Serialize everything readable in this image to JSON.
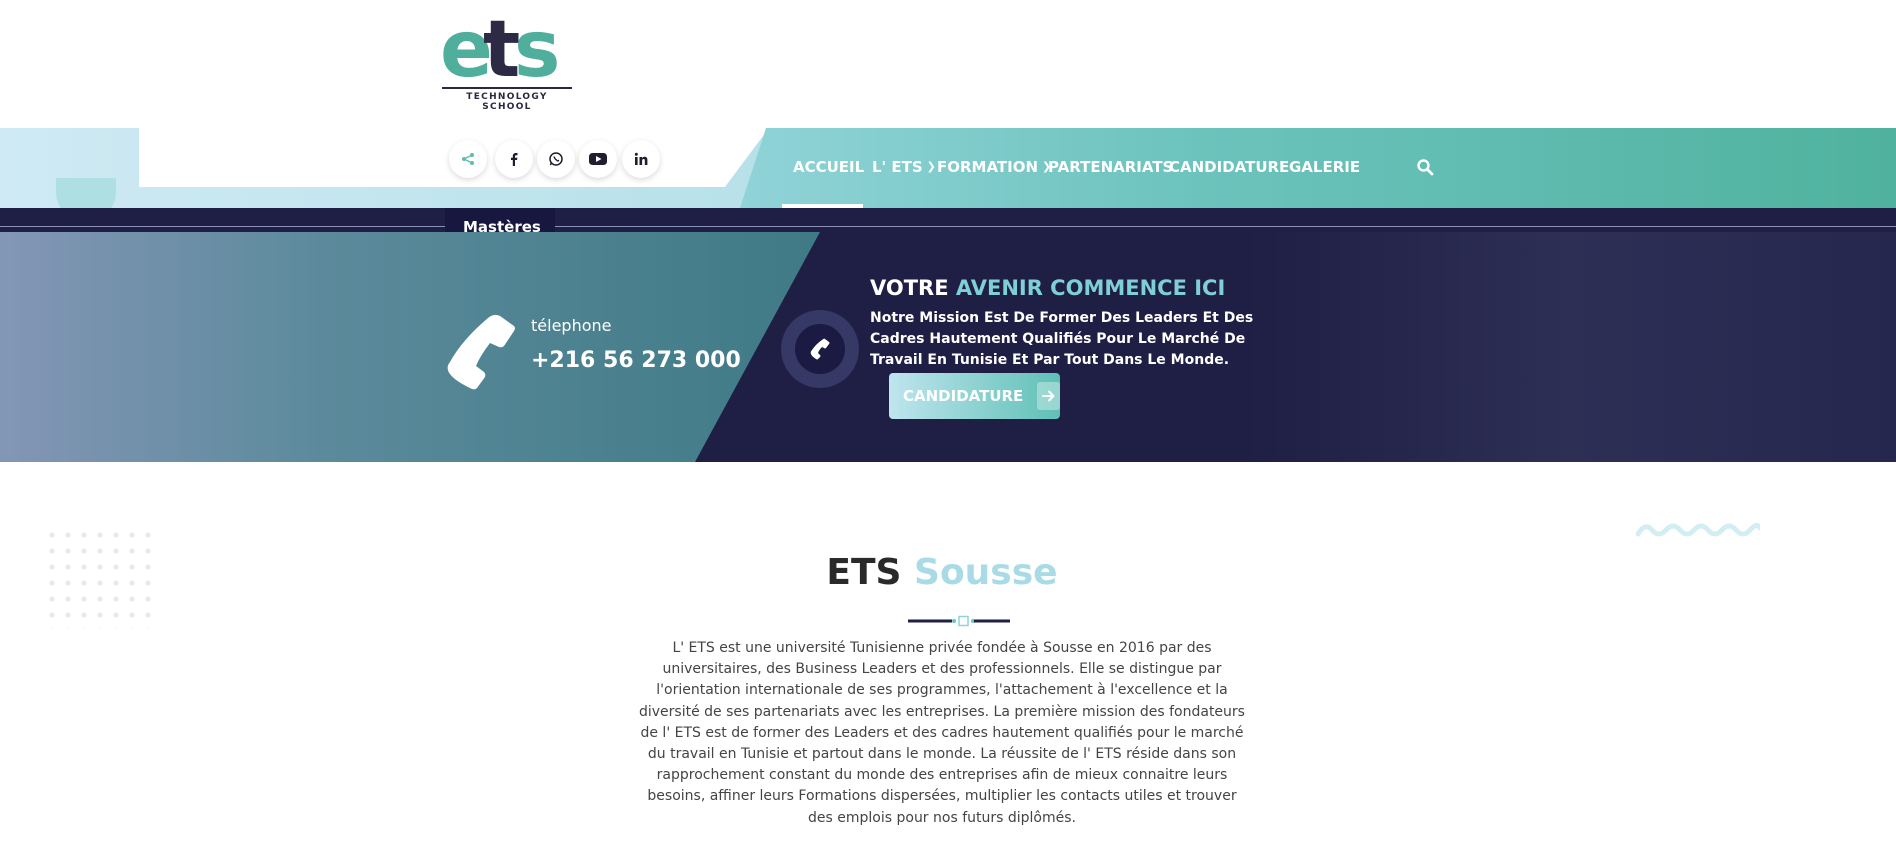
{
  "logo": {
    "wordmark": "ets",
    "tagline": "TECHNOLOGY SCHOOL"
  },
  "social": [
    {
      "icon": "share-icon",
      "name": "share"
    },
    {
      "icon": "facebook-icon",
      "name": "facebook"
    },
    {
      "icon": "whatsapp-icon",
      "name": "whatsapp"
    },
    {
      "icon": "youtube-icon",
      "name": "youtube"
    },
    {
      "icon": "linkedin-icon",
      "name": "linkedin"
    }
  ],
  "nav": {
    "items": [
      {
        "label": "ACCUEIL",
        "active": true,
        "has_dropdown": false
      },
      {
        "label": "L' ETS",
        "active": false,
        "has_dropdown": true
      },
      {
        "label": "FORMATION",
        "active": false,
        "has_dropdown": true
      },
      {
        "label": "PARTENARIATS",
        "active": false,
        "has_dropdown": false
      },
      {
        "label": "CANDIDATURE",
        "active": false,
        "has_dropdown": false
      },
      {
        "label": "GALERIE",
        "active": false,
        "has_dropdown": false
      }
    ],
    "dropdown_peek": "Mastères",
    "search_icon": "search-icon"
  },
  "hero": {
    "tel_label": "télephone",
    "tel_number": "+216 56 273 000",
    "title_part1": "VOTRE ",
    "title_accent": "AVENIR COMMENCE ICI",
    "text": "Notre Mission Est De Former Des Leaders Et Des Cadres Hautement Qualifiés Pour Le Marché De Travail En Tunisie Et Par Tout Dans Le Monde.",
    "cta_label": "CANDIDATURE"
  },
  "about": {
    "title_part1": "ETS ",
    "title_accent": "Sousse",
    "body": "L' ETS est une université Tunisienne privée fondée à Sousse en 2016 par des universitaires, des Business Leaders et des professionnels. Elle se distingue par l'orientation internationale de ses programmes, l'attachement à l'excellence et la diversité de ses partenariats avec les entreprises. La première mission des fondateurs de l' ETS est de former des Leaders et des cadres hautement qualifiés pour le marché du travail en Tunisie et partout dans le monde. La réussite de l' ETS réside dans son rapprochement constant du monde des entreprises afin de mieux connaitre leurs besoins, affiner leurs Formations dispersées, multiplier les contacts utiles et trouver des emplois pour nos futurs diplômés."
  },
  "colors": {
    "navy": "#1f1e45",
    "teal": "#4fb29e",
    "light_teal": "#a8dbe6",
    "accent_text": "#7fd0d6"
  }
}
